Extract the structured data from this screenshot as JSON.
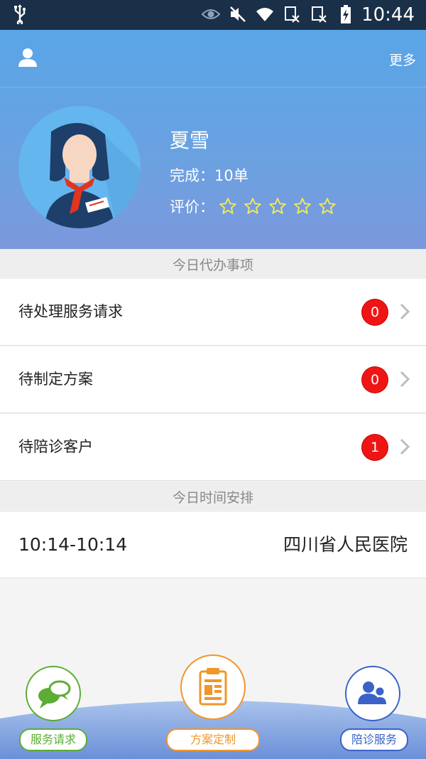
{
  "status_bar": {
    "time": "10:44",
    "icons": [
      "usb-icon",
      "eye-icon",
      "mute-icon",
      "wifi-icon",
      "no-sim-icon",
      "no-sim-icon",
      "battery-charging-icon"
    ]
  },
  "header": {
    "more_label": "更多",
    "user_icon": "user-icon"
  },
  "profile": {
    "name": "夏雪",
    "completed_label": "完成：10单",
    "rating_label": "评价：",
    "rating_value": 0,
    "rating_max": 5
  },
  "todo": {
    "title": "今日代办事项",
    "items": [
      {
        "label": "待处理服务请求",
        "count": "0"
      },
      {
        "label": "待制定方案",
        "count": "0"
      },
      {
        "label": "待陪诊客户",
        "count": "1"
      }
    ]
  },
  "schedule": {
    "title": "今日时间安排",
    "items": [
      {
        "time": "10:14-10:14",
        "place": "四川省人民医院"
      }
    ]
  },
  "bottom_nav": {
    "items": [
      {
        "label": "服务请求",
        "icon": "chat-bubbles-icon",
        "color": "#5cac36"
      },
      {
        "label": "方案定制",
        "icon": "clipboard-icon",
        "color": "#f0962a"
      },
      {
        "label": "陪诊服务",
        "icon": "users-icon",
        "color": "#3a62c8"
      }
    ]
  },
  "colors": {
    "header_top": "#59a5e7",
    "header_bottom": "#7b98dc",
    "badge": "#f01515",
    "star": "#f2e75a"
  }
}
